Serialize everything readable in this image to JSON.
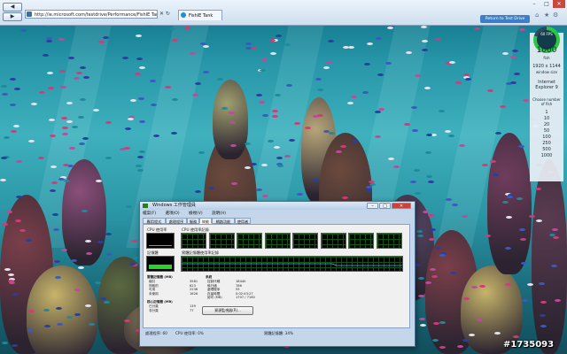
{
  "browser": {
    "nav": {
      "back": "◀",
      "forward": "▶"
    },
    "address": "http://ie.microsoft.com/testdrive/Performance/FishIE Tank/",
    "address_icons": "✕ ↻",
    "tab_title": "FishIE Tank",
    "window_controls": {
      "minimize": "–",
      "maximize": "□",
      "close": "✕"
    },
    "toolbar_icons": {
      "home": "⌂",
      "favorites": "★",
      "tools": "⚙"
    }
  },
  "test_drive": {
    "return_label": "Return to Test Drive",
    "fps": "60 FPS",
    "fish_count_value": "1000",
    "fish_count_unit": "fish",
    "window_size_value": "1920 x 1144",
    "window_size_label": "window size",
    "browser_name": "Internet Explorer 9",
    "choose_label": "Choose number of fish",
    "fish_options": [
      "1",
      "10",
      "20",
      "50",
      "100",
      "250",
      "500",
      "1000"
    ]
  },
  "task_manager": {
    "title": "Windows 工作管理員",
    "controls": {
      "minimize": "–",
      "maximize": "□",
      "close": "✕"
    },
    "menu": [
      "檔案(F)",
      "選項(O)",
      "檢視(V)",
      "說明(H)"
    ],
    "tabs": [
      "應用程式",
      "處理程序",
      "服務",
      "效能",
      "網路功能",
      "使用者"
    ],
    "active_tab": "效能",
    "cpu_usage_label": "CPU 使用率",
    "cpu_history_label": "CPU 使用率記錄",
    "memory_label": "記憶體",
    "memory_history_label": "實體記憶體使用率記錄",
    "cpu_usage_value": "0 %",
    "cpu_percent": 0.0,
    "cpu_core_count": 8,
    "physical_memory": {
      "title": "實體記憶體 (MB)",
      "rows": [
        [
          "總共",
          "3581"
        ],
        [
          "快取的",
          "623"
        ],
        [
          "可用",
          "2236"
        ],
        [
          "未使用",
          "1626"
        ]
      ]
    },
    "system": {
      "title": "系統",
      "rows": [
        [
          "控制代碼",
          "18440"
        ],
        [
          "執行緒",
          "786"
        ],
        [
          "處理程序",
          "55"
        ],
        [
          "存留時間",
          "0:02:43:27"
        ],
        [
          "認可 (MB)",
          "1707 / 7160"
        ]
      ]
    },
    "kernel_memory": {
      "title": "核心記憶體 (MB)",
      "rows": [
        [
          "已分頁",
          "139"
        ],
        [
          "非分頁",
          "77"
        ]
      ]
    },
    "resource_monitor_button": "資源監視器(R)...",
    "status": {
      "processes": "處理程序: 60",
      "cpu": "CPU 使用率: 0%",
      "memory": "實體記憶體: 34%"
    }
  },
  "watermark": "#1735093"
}
